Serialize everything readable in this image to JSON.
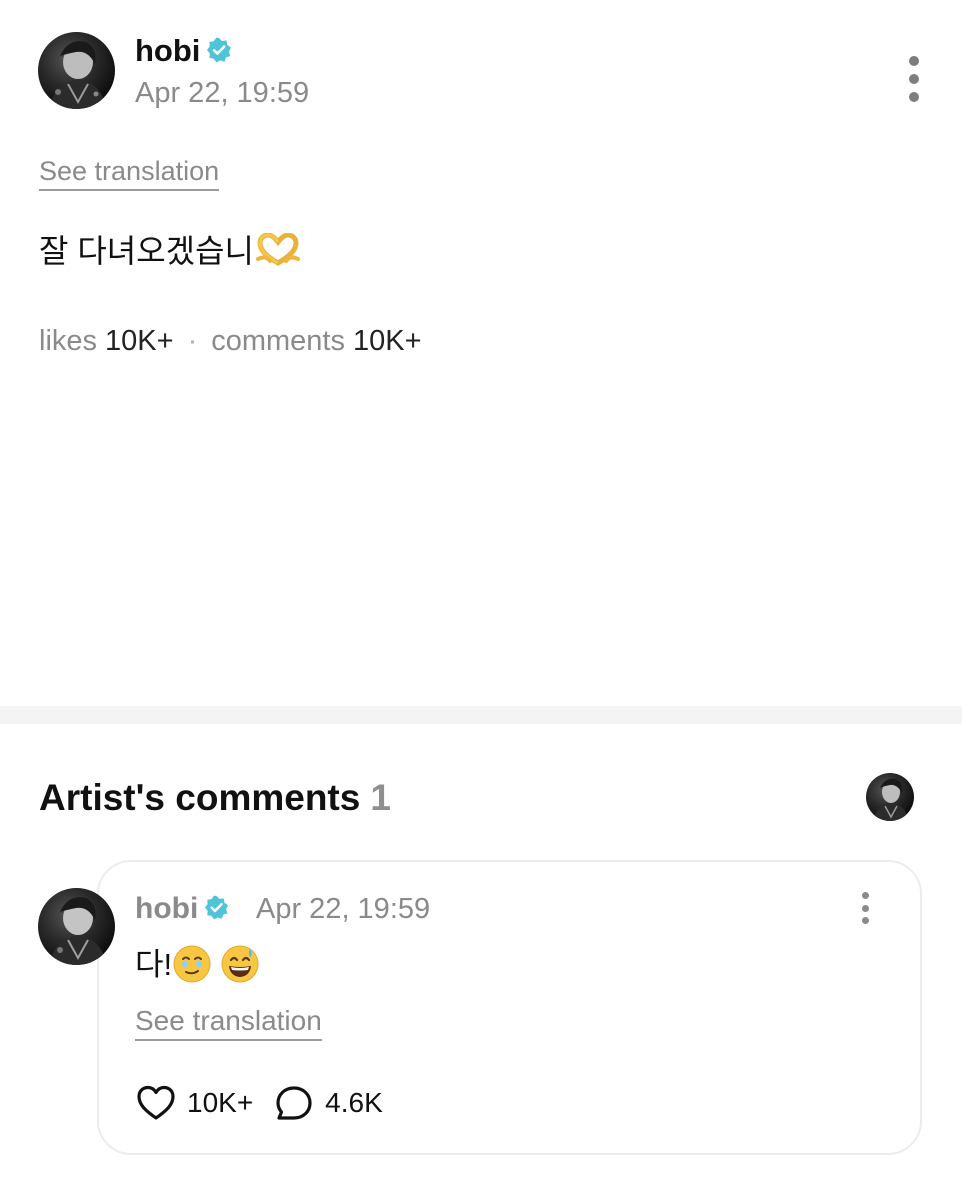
{
  "post": {
    "author": "hobi",
    "timestamp": "Apr 22, 19:59",
    "see_translation": "See translation",
    "text": "잘 다녀오겠습니",
    "text_emoji": "heart-hands-emoji",
    "likes_label": "likes",
    "likes_count": "10K+",
    "separator": "·",
    "comments_label": "comments",
    "comments_count": "10K+"
  },
  "artist_comments": {
    "title": "Artist's comments",
    "count": "1",
    "comment": {
      "author": "hobi",
      "timestamp": "Apr 22, 19:59",
      "text": "다!",
      "emojis": [
        "face-holding-back-tears-emoji",
        "grinning-face-with-sweat-emoji"
      ],
      "see_translation": "See translation",
      "like_count": "10K+",
      "reply_count": "4.6K"
    }
  },
  "colors": {
    "verified_badge": "#4fc3d8",
    "muted_text": "#8a8a8a",
    "divider": "#f4f4f4",
    "card_border": "#ececec"
  }
}
